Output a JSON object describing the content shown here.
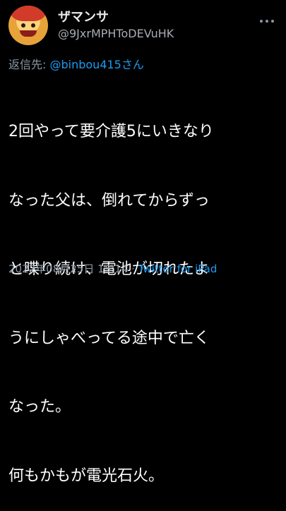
{
  "tweet": {
    "display_name": "ザマンサ",
    "handle": "@9JxrMPHToDEVuHK",
    "reply_prefix": "返信先: ",
    "reply_to": "@binbou415さん",
    "text_lines": [
      "2回やって要介護5にいきなり",
      "なった父は、倒れてからずっ",
      "と喋り続け、電池が切れたよ",
      "うにしゃべってる途中で亡く",
      "なった。",
      "何もかもが電光石火。"
    ],
    "timestamp": "2022年08月25日 13:14",
    "separator": " · ",
    "source": "Twitter for iPad"
  },
  "icons": {
    "avatar": "avatar-face",
    "more": "more-icon"
  },
  "colors": {
    "background": "#000000",
    "link": "#1d9bf0",
    "muted": "#8b98a5",
    "text": "#ffffff"
  }
}
